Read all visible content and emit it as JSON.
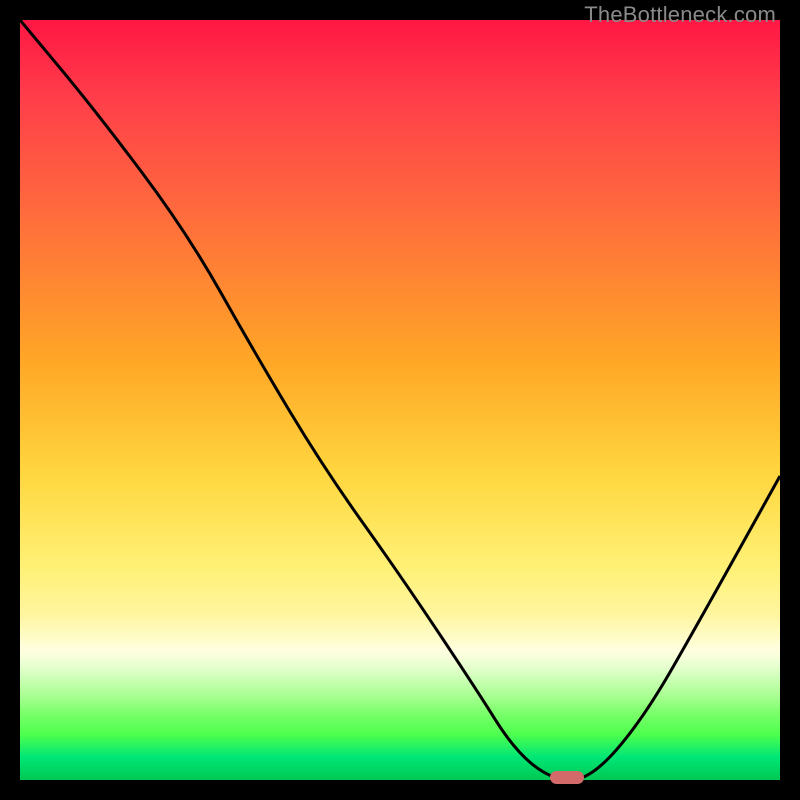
{
  "watermark": "TheBottleneck.com",
  "colors": {
    "background": "#000000",
    "gradient_top": "#ff1744",
    "gradient_mid": "#ffd740",
    "gradient_bottom": "#00c853",
    "curve": "#000000",
    "marker": "#d36a6a"
  },
  "chart_data": {
    "type": "line",
    "title": "",
    "xlabel": "",
    "ylabel": "",
    "xlim": [
      0,
      100
    ],
    "ylim": [
      0,
      100
    ],
    "series": [
      {
        "name": "bottleneck-curve",
        "x": [
          0,
          10,
          22,
          31,
          40,
          50,
          60,
          65,
          70,
          75,
          82,
          90,
          100
        ],
        "values": [
          100,
          88,
          72,
          56,
          41,
          27,
          12,
          4,
          0,
          0,
          8,
          22,
          40
        ]
      }
    ],
    "annotations": [
      {
        "name": "optimal-marker",
        "x": 72,
        "y": 0
      }
    ]
  }
}
